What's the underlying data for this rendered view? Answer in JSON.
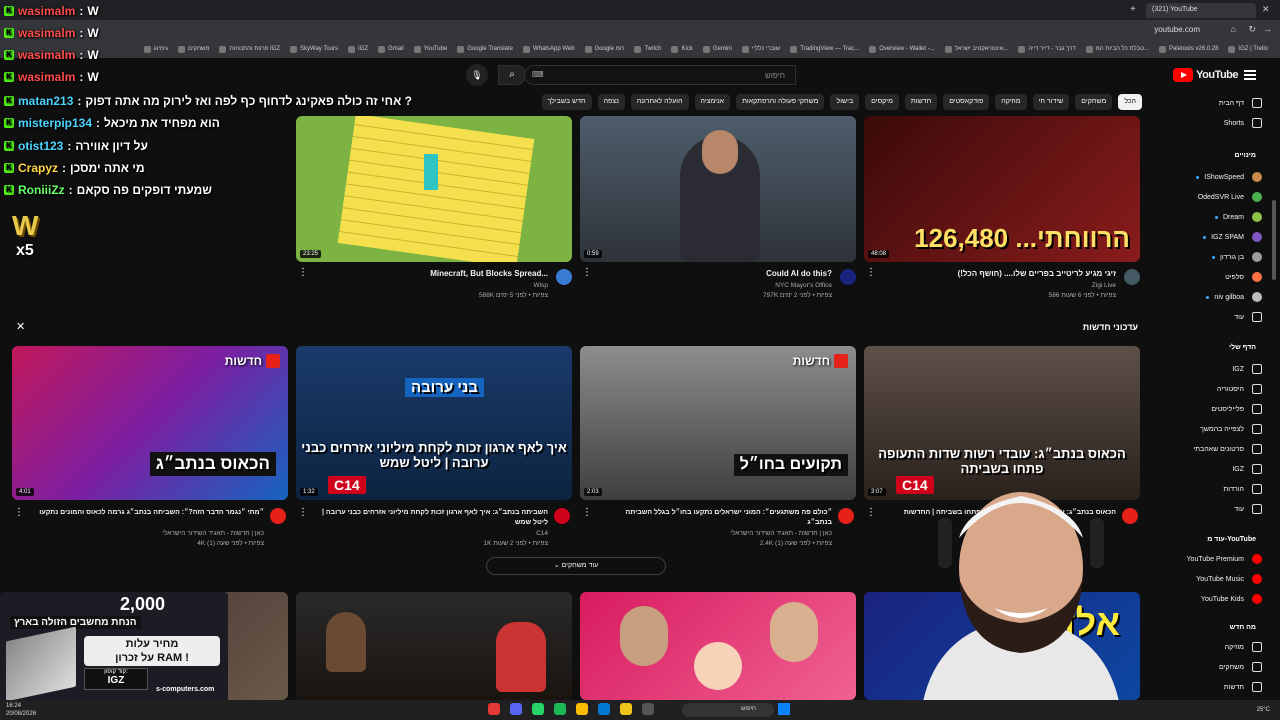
{
  "browser": {
    "tabs": [
      "(321) YouTube"
    ],
    "url": "youtube.com",
    "bookmarks": [
      "IGZ | Trello",
      "Paletools v26.0.28",
      "טבלת כל הביות המ...",
      "דרך גבר - דייר דייה",
      "אינטראקטיב ישראל...",
      "Overview - Wallet -...",
      "TradingView — Trac...",
      "שוברי כלליי",
      "Gemini",
      "Kick",
      "Twitch",
      "Google רומ",
      "WhatsApp Web",
      "Google Translate",
      "YouTube",
      "Gmail",
      "IGZ",
      "SkyWay Tours",
      "פרוות והתנוחות IGZ",
      "משחקים",
      "גימינג"
    ]
  },
  "header": {
    "logo_text": "YouTube",
    "search_placeholder": "חיפוש",
    "search_icon": "search-icon",
    "mic_icon": "mic-icon"
  },
  "chips": [
    "הכל",
    "משחקים",
    "שידור חי",
    "מוזיקה",
    "פודקאסטים",
    "חדשות",
    "מיקסים",
    "בישול",
    "משחקי פעולה והרפתקאות",
    "אנימציה",
    "הועלה לאחרונה",
    "נצפה",
    "חדש בשבילך"
  ],
  "sidebar": {
    "top": [
      {
        "label": "דף הבית",
        "icon": "home-icon"
      },
      {
        "label": "Shorts",
        "icon": "shorts-icon"
      }
    ],
    "subs_header": "מינויים",
    "subs": [
      {
        "label": "IShowSpeed",
        "color": "#c98a4b",
        "live": true
      },
      {
        "label": "OdedSVR Live",
        "color": "#4caf50",
        "live": false
      },
      {
        "label": "Dream",
        "color": "#8bc34a",
        "live": true
      },
      {
        "label": "IGZ SPAM",
        "color": "#7e57c2",
        "live": true
      },
      {
        "label": "בן גורדון",
        "color": "#9e9e9e",
        "live": true
      },
      {
        "label": "סלפיט",
        "color": "#ff7043",
        "live": false
      },
      {
        "label": "niv gilboa",
        "color": "#bdbdbd",
        "live": true
      },
      {
        "label": "עוד",
        "color": "",
        "live": false
      }
    ],
    "you_header": "הדף שלי",
    "you": [
      {
        "label": "IGZ",
        "icon": "channel-icon"
      },
      {
        "label": "היסטוריה",
        "icon": "history-icon"
      },
      {
        "label": "פלייליסטים",
        "icon": "playlist-icon"
      },
      {
        "label": "לצפייה בהמשך",
        "icon": "watch-later-icon"
      },
      {
        "label": "סרטונים שאהבתי",
        "icon": "like-icon"
      },
      {
        "label": "IGZ",
        "icon": "video-icon"
      },
      {
        "label": "הורדות",
        "icon": "download-icon"
      },
      {
        "label": "עוד",
        "icon": "chevron-down-icon"
      }
    ],
    "more_header": "עוד מ-YouTube",
    "more": [
      {
        "label": "YouTube Premium",
        "icon": "yt-premium-icon"
      },
      {
        "label": "YouTube Music",
        "icon": "yt-music-icon"
      },
      {
        "label": "YouTube Kids",
        "icon": "yt-kids-icon"
      }
    ],
    "explore_header": "מה חדש",
    "explore": [
      {
        "label": "מוזיקה",
        "icon": "music-icon"
      },
      {
        "label": "משחקים",
        "icon": "gaming-icon"
      },
      {
        "label": "חדשות",
        "icon": "news-icon"
      }
    ]
  },
  "chat": [
    {
      "user": "wasimalm",
      "msg": "W",
      "color": "red"
    },
    {
      "user": "wasimalm",
      "msg": "W",
      "color": "red"
    },
    {
      "user": "wasimalm",
      "msg": "W",
      "color": "red"
    },
    {
      "user": "wasimalm",
      "msg": "W",
      "color": "red"
    },
    {
      "user": "matan213",
      "msg": "אחי זה כולה פאקינג לדחוף כף לפה ואז לירוק מה אתה דפוק ?",
      "color": "blue"
    },
    {
      "user": "misterpip134",
      "msg": "הוא מפחיד את מיכאל",
      "color": "blue"
    },
    {
      "user": "otist123",
      "msg": "על דיון אווירה",
      "color": "blue"
    },
    {
      "user": "Crapyz",
      "msg": "מי אתה ימסכן",
      "color": "yellow"
    },
    {
      "user": "RoniiiZz",
      "msg": "שמעתי דופקים פה סקאם",
      "color": "green"
    }
  ],
  "emote": {
    "text": "W",
    "multiplier": "x5"
  },
  "row1": [
    {
      "title": "Minecraft, But Blocks Spread...",
      "channel": "Wisp",
      "stats": "588K צפיות • לפני 5 ימים",
      "duration": "23:25",
      "overlay": ""
    },
    {
      "title": "Could AI do this?",
      "channel": "NYC Mayor's Office",
      "stats": "797K צפיות • לפני 2 ימים",
      "duration": "0:59",
      "overlay": ""
    },
    {
      "title": "זיגי מגיע לריטייב בפריים שלו.... (חושף הכל!)",
      "channel": "Zigi Live",
      "stats": "586 צפיות • לפני 6 שעות",
      "duration": "48:08",
      "overlay": "הרווחתי... 126,480"
    }
  ],
  "news_heading": "עדכוני חדשות",
  "news": [
    {
      "title": "״מתי ״נגמר הדבר הזה?״: השביתה בנתב״ג גרמה לכאוס והמונים נתקעו",
      "channel": "כאן | חדשות - תאגיד השידור הישראלי",
      "stats": "4K צפיות • לפני שעה (1)",
      "duration": "4:01",
      "overlay": "הכאוס בנתב״ג",
      "tag": "חדשות"
    },
    {
      "title": "השביתה בנתב״ג: איך לאף ארגון זכות לקחת מיליוני אזרחים כבני ערובה | ליטל שמש",
      "channel": "C14",
      "stats": "1K צפיות • לפני 2 שעות",
      "duration": "1:32",
      "overlay": "איך לאף ארגון זכות לקחת מיליוני אזרחים כבני ערובה | ליטל שמש",
      "tag": "בני ערובה"
    },
    {
      "title": "״כולם פה משתגעים״: המוני ישראלים נתקעו בחו״ל בגלל השביתה בנתב״ג",
      "channel": "כאן | חדשות - תאגיד השידור הישראלי",
      "stats": "2.4K צפיות • לפני שעה (1)",
      "duration": "2:03",
      "overlay": "תקועים בחו״ל",
      "tag": "חדשות"
    },
    {
      "title": "הכאוס בנתב״ג: עובדי רשות שדות התעופה פתחו בשביתה | החדשות",
      "channel": "",
      "stats": "",
      "duration": "3:07",
      "overlay": "הכאוס בנתב״ג: עובדי רשות שדות התעופה פתחו בשביתה",
      "tag": ""
    }
  ],
  "show_more": "עוד משחקים",
  "promo": {
    "headline": "הנחת מחשבים הזולה בארץ",
    "price": "2,000",
    "sub1": "מחיר עלות",
    "sub2": "על זכרון RAM !",
    "code_label": "קוד קופון:",
    "code": "IGZ",
    "site": "s-computers.com"
  },
  "taskbar": {
    "search": "חיפוש",
    "time": "16:24",
    "date": "20/08/2026",
    "weather": "25°C"
  }
}
